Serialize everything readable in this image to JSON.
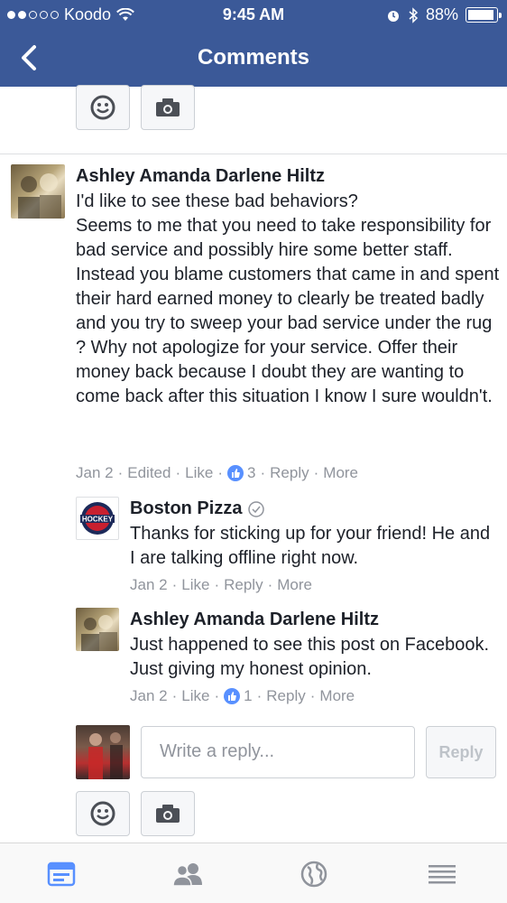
{
  "status_bar": {
    "carrier": "Koodo",
    "time": "9:45 AM",
    "battery": "88%",
    "battery_level": 0.88
  },
  "nav": {
    "title": "Comments",
    "back_icon": "chevron-left-icon"
  },
  "comments": [
    {
      "author": "Ashley Amanda Darlene Hiltz",
      "body": [
        "I'd like to see these bad behaviors?",
        "Seems to me that you need to take responsibility for bad service and possibly hire some better staff.",
        "Instead you blame customers that came in and spent their hard earned money to clearly be treated badly and you try to sweep your bad service under the rug ? Why not apologize for your service. Offer their money back because I doubt they are wanting to come back after this situation I know I sure wouldn't."
      ],
      "date": "Jan 2",
      "edited": "Edited",
      "like": "Like",
      "like_count": "3",
      "reply": "Reply",
      "more": "More"
    },
    {
      "author": "Boston Pizza",
      "verified_icon": "check-circle-icon",
      "body": "Thanks for sticking up for your friend! He and I are talking offline right now.",
      "date": "Jan 2",
      "like": "Like",
      "reply": "Reply",
      "more": "More",
      "avatar_text": "HOCKEY"
    },
    {
      "author": "Ashley Amanda Darlene Hiltz",
      "body": "Just happened to see this post on Facebook. Just giving my honest opinion.",
      "date": "Jan 2",
      "like": "Like",
      "like_count": "1",
      "reply": "Reply",
      "more": "More"
    }
  ],
  "composer": {
    "placeholder": "Write a reply...",
    "reply_label": "Reply"
  },
  "colors": {
    "brand": "#3b5998",
    "like_blue": "#5890ff",
    "meta_gray": "#90949c"
  },
  "tabs": [
    {
      "name": "news-feed-icon",
      "active": true
    },
    {
      "name": "friends-icon",
      "active": false
    },
    {
      "name": "globe-icon",
      "active": false
    },
    {
      "name": "menu-icon",
      "active": false
    }
  ]
}
